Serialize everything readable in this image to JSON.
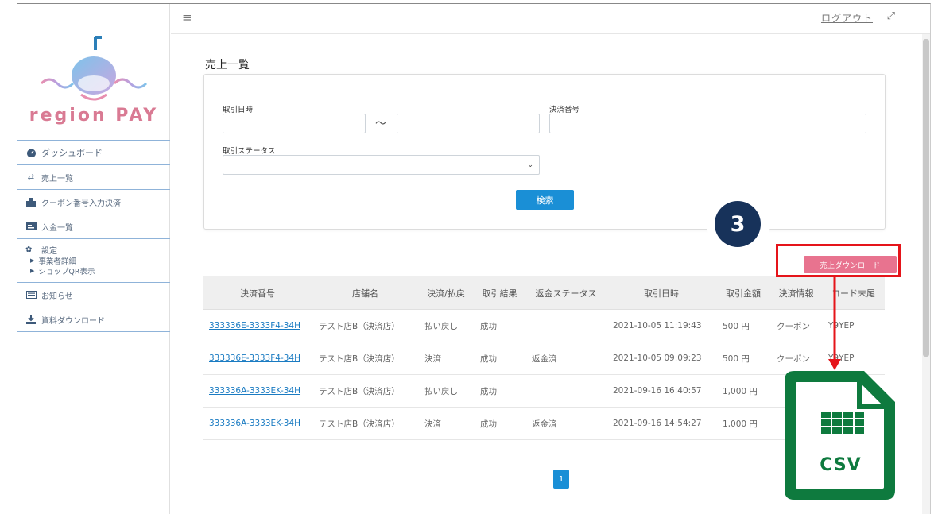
{
  "app": {
    "logo_text": "region PAY"
  },
  "topbar": {
    "menu_icon": "hamburger-icon",
    "logout_label": "ログアウト",
    "expand_icon": "expand-icon"
  },
  "sidebar": {
    "items": [
      {
        "label": "ダッシュボード",
        "icon": "dashboard-icon"
      },
      {
        "label": "売上一覧",
        "icon": "exchange-icon"
      },
      {
        "label": "クーポン番号入力決済",
        "icon": "coupon-icon"
      },
      {
        "label": "入金一覧",
        "icon": "card-icon"
      },
      {
        "label": "設定",
        "icon": "gear-icon",
        "children": [
          "事業者詳細",
          "ショップQR表示"
        ]
      },
      {
        "label": "お知らせ",
        "icon": "news-icon"
      },
      {
        "label": "資料ダウンロード",
        "icon": "download-icon"
      }
    ]
  },
  "main": {
    "title": "売上一覧",
    "filters": {
      "date_label": "取引日時",
      "range_sep": "〜",
      "payment_no_label": "決済番号",
      "status_label": "取引ステータス",
      "search_label": "検索"
    },
    "download_label": "売上ダウンロード",
    "table": {
      "headers": [
        "決済番号",
        "店舗名",
        "決済/払戻",
        "取引結果",
        "返金ステータス",
        "取引日時",
        "取引金額",
        "決済情報",
        "コード末尾"
      ],
      "rows": [
        [
          "333336E-3333F4-34H",
          "テスト店B（決済店）",
          "払い戻し",
          "成功",
          "",
          "2021-10-05 11:19:43",
          "500 円",
          "クーポン",
          "Y9YEP"
        ],
        [
          "333336E-3333F4-34H",
          "テスト店B（決済店）",
          "決済",
          "成功",
          "返金済",
          "2021-10-05 09:09:23",
          "500 円",
          "クーポン",
          "Y9YEP"
        ],
        [
          "333336A-3333EK-34H",
          "テスト店B（決済店）",
          "払い戻し",
          "成功",
          "",
          "2021-09-16 16:40:57",
          "1,000 円",
          "",
          ""
        ],
        [
          "333336A-3333EK-34H",
          "テスト店B（決済店）",
          "決済",
          "成功",
          "返金済",
          "2021-09-16 14:54:27",
          "1,000 円",
          "",
          ""
        ]
      ]
    },
    "pagination": {
      "current": "1"
    }
  },
  "annotation": {
    "step": "3",
    "csv_label": "CSV",
    "accent": "#e5141a",
    "csv_color": "#0e7a3e"
  }
}
